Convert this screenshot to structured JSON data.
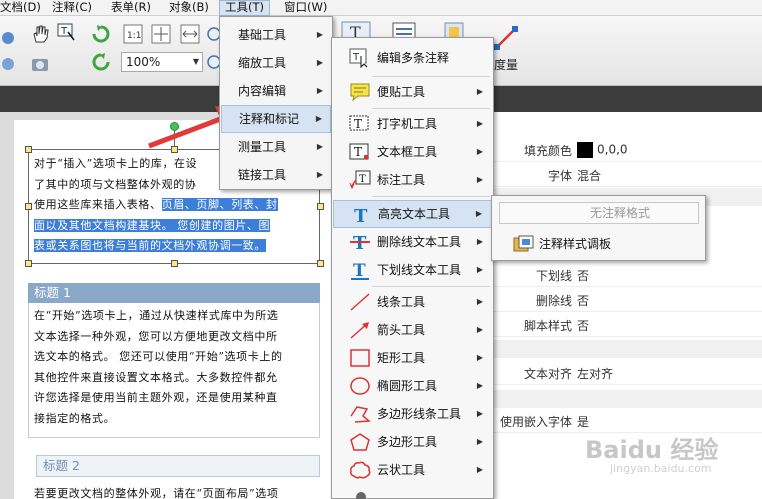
{
  "menubar": {
    "items": [
      "文档(D)",
      "注释(C)",
      "表单(R)",
      "对象(B)",
      "工具(T)",
      "窗口(W)"
    ]
  },
  "toolbar": {
    "zoom_value": "100%",
    "measure_label": "度量"
  },
  "tools_menu": {
    "items": [
      "基础工具",
      "缩放工具",
      "内容编辑",
      "注释和标记",
      "测量工具",
      "链接工具"
    ],
    "highlighted_index": 3
  },
  "annot_menu": {
    "items": [
      "编辑多条注释",
      "便贴工具",
      "打字机工具",
      "文本框工具",
      "标注工具",
      "高亮文本工具",
      "删除线文本工具",
      "下划线文本工具",
      "线条工具",
      "箭头工具",
      "矩形工具",
      "椭圆形工具",
      "多边形线条工具",
      "多边形工具",
      "云状工具"
    ],
    "highlighted_index": 5
  },
  "highlight_submenu": {
    "no_style": "无注释格式",
    "style_palette": "注释样式调板"
  },
  "document": {
    "para1_plain": [
      "对于“插入”选项卡上的库，在设",
      "了其中的项与文档整体外观的协",
      "使用这些库来插入表格、"
    ],
    "para1_sel_tail": "页眉、页脚、列表、封",
    "para1_sel_lines": [
      "面以及其他文档构建基块。 您创建的图片、图",
      "表或关系图也将与当前的文档外观协调一致。"
    ],
    "heading1": "标题 1",
    "para2": [
      "在“开始”选项卡上，通过从快速样式库中为所选",
      "文本选择一种外观，您可以方便地更改文档中所",
      "选文本的格式。 您还可以使用“开始”选项卡上的",
      "其他控件来直接设置文本格式。大多数控件都允",
      "许您选择是使用当前主题外观，还是使用某种直",
      "接指定的格式。"
    ],
    "heading2": "标题 2",
    "para3": "若要更改文档的整体外观，请在“页面布局”选项"
  },
  "properties": [
    {
      "key": "填充颜色",
      "value": "0,0,0"
    },
    {
      "key": "字体",
      "value": "混合"
    },
    {
      "key": "下划线",
      "value": "否"
    },
    {
      "key": "删除线",
      "value": "否"
    },
    {
      "key": "脚本样式",
      "value": "否"
    },
    {
      "key": "文本对齐",
      "value": "左对齐"
    },
    {
      "key": "使用嵌入字体",
      "value": "是"
    }
  ],
  "watermark": {
    "brand": "Baidu 经验",
    "url": "jingyan.baidu.com"
  },
  "colors": {
    "selection": "#3d7fd8",
    "arrow": "#e03a3a",
    "menu_highlight": "#d5e3f3"
  }
}
